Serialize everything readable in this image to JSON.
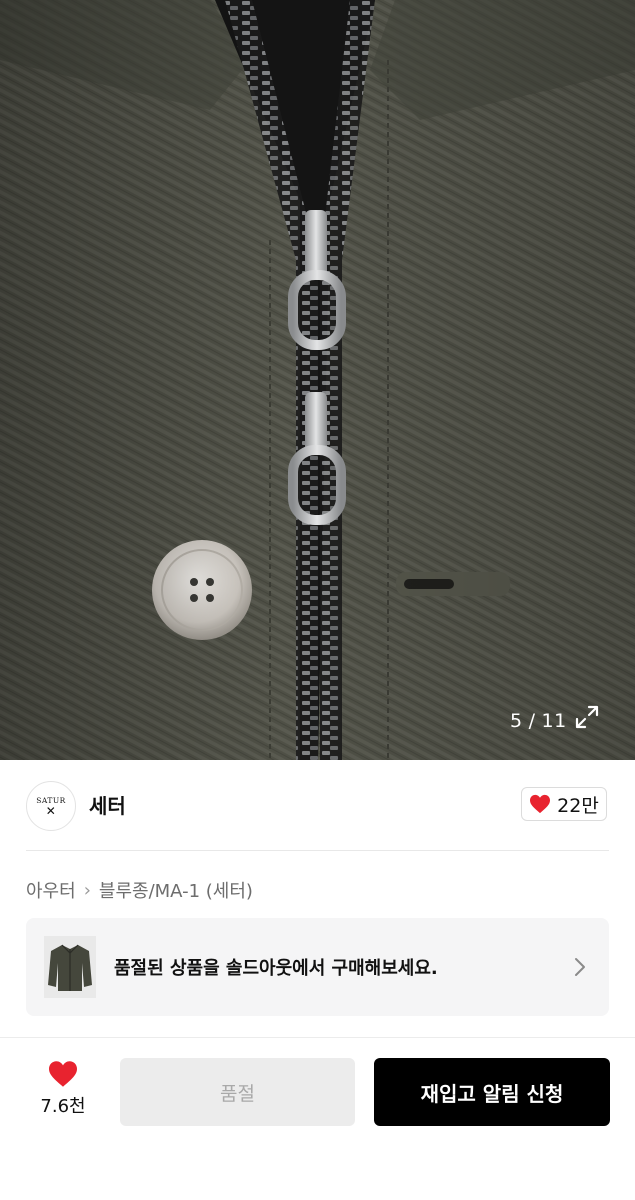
{
  "gallery": {
    "current": "5",
    "separator": "/",
    "total": "11"
  },
  "brand": {
    "name": "세터",
    "logo_text_top": "SATUR",
    "logo_text_mark": "✕",
    "likes": "22만"
  },
  "breadcrumb": {
    "items": [
      "아우터",
      "블루종/MA-1 (세터)"
    ],
    "separator": "›"
  },
  "banner": {
    "text": "품절된 상품을 솔드아웃에서 구매해보세요."
  },
  "bottom_bar": {
    "wish_count": "7.6천",
    "soldout_label": "품절",
    "restock_label": "재입고 알림 신청"
  },
  "colors": {
    "heart": "#e8232f",
    "fabric": "#4e4f45",
    "primary_button": "#000000"
  }
}
